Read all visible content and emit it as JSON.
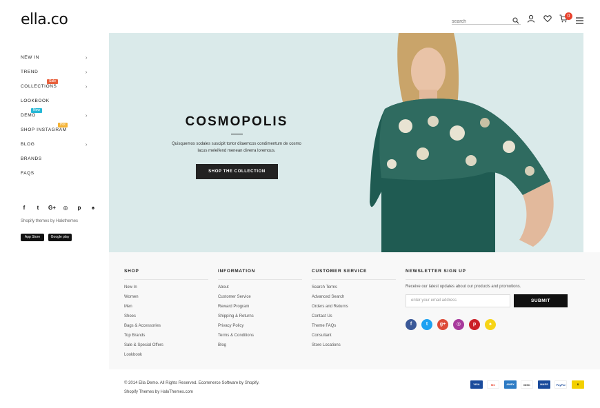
{
  "header": {
    "logo": "ella.co",
    "search_placeholder": "search",
    "cart_count": "0"
  },
  "sidebar": {
    "items": [
      {
        "label": "NEW IN",
        "chevron": true
      },
      {
        "label": "TREND",
        "chevron": true
      },
      {
        "label": "COLLECTIONS",
        "chevron": true,
        "tag": "Sale",
        "tag_color": "#e8603c"
      },
      {
        "label": "LOOKBOOK",
        "chevron": false
      },
      {
        "label": "DEMO",
        "chevron": true,
        "tag": "New",
        "tag_color": "#27b8d6"
      },
      {
        "label": "SHOP INSTAGRAM",
        "chevron": false,
        "tag": "Hot",
        "tag_color": "#f5b335"
      },
      {
        "label": "BLOG",
        "chevron": true
      },
      {
        "label": "BRANDS",
        "chevron": false
      },
      {
        "label": "FAQS",
        "chevron": false
      }
    ],
    "socials": [
      "f",
      "t",
      "G+",
      "◎",
      "p",
      "♠"
    ],
    "credit": "Shopify themes by Halothemes",
    "badges": [
      "App Store",
      "Google play"
    ]
  },
  "hero": {
    "title": "COSMOPOLIS",
    "text": "Quisquemos sodales suscipit tortor ditaemcos condimentum de cosmo lacus meleifend menean diverra loremous.",
    "button": "SHOP THE COLLECTION"
  },
  "footer": {
    "shop": {
      "title": "SHOP",
      "links": [
        "New In",
        "Women",
        "Men",
        "Shoes",
        "Bags & Accessories",
        "Top Brands",
        "Sale & Special Offers",
        "Lookbook"
      ]
    },
    "information": {
      "title": "INFORMATION",
      "links": [
        "About",
        "Customer Service",
        "Reward Program",
        "Shipping & Returns",
        "Privacy Policy",
        "Terms & Conditions",
        "Blog"
      ]
    },
    "customer_service": {
      "title": "CUSTOMER SERVICE",
      "links": [
        "Search Terms",
        "Advanced Search",
        "Orders and Returns",
        "Contact Us",
        "Theme FAQs",
        "Consultant",
        "Store Locations"
      ]
    },
    "newsletter": {
      "title": "NEWSLETTER SIGN UP",
      "text": "Receive our latest updates about our products and promotions.",
      "placeholder": "enter your email address",
      "button": "SUBMIT",
      "socials": [
        {
          "icon": "f",
          "color": "#3b5998"
        },
        {
          "icon": "t",
          "color": "#1da1f2"
        },
        {
          "icon": "g+",
          "color": "#dd4b39"
        },
        {
          "icon": "◎",
          "color": "#a83a9c"
        },
        {
          "icon": "p",
          "color": "#cb2027"
        },
        {
          "icon": "♠",
          "color": "#f7d417"
        }
      ]
    }
  },
  "bottom": {
    "copyright": "© 2014 Ella Demo. All Rights Reserved. Ecommerce Software by Shopify.",
    "themes": "Shopify Themes by HaloThemes.com",
    "payments": [
      {
        "label": "VISA",
        "color": "#1a4b9c"
      },
      {
        "label": "MC",
        "color": "#ffffff"
      },
      {
        "label": "AMEX",
        "color": "#2d7bc4"
      },
      {
        "label": "DISC",
        "color": "#ffffff"
      },
      {
        "label": "MAES",
        "color": "#1a4b9c"
      },
      {
        "label": "PayPal",
        "color": "#ffffff"
      },
      {
        "label": "$",
        "color": "#f3d000"
      }
    ]
  }
}
